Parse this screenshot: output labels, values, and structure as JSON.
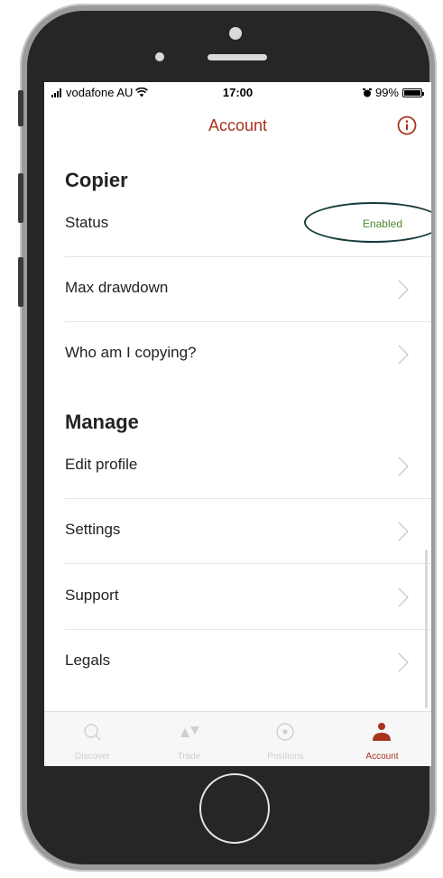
{
  "status_bar": {
    "carrier": "vodafone AU",
    "time": "17:00",
    "battery": "99%",
    "battery_level": 0.99
  },
  "nav": {
    "title": "Account",
    "info_icon": "info-circle-icon"
  },
  "sections": {
    "copier": {
      "title": "Copier",
      "status_label": "Status",
      "status_value": "Enabled",
      "max_drawdown_label": "Max drawdown",
      "who_copying_label": "Who am I copying?"
    },
    "manage": {
      "title": "Manage",
      "edit_profile_label": "Edit profile",
      "settings_label": "Settings",
      "support_label": "Support",
      "legals_label": "Legals"
    }
  },
  "tabs": [
    {
      "label": "Discover",
      "icon": "search-icon",
      "active": false
    },
    {
      "label": "Trade",
      "icon": "trade-arrows-icon",
      "active": false
    },
    {
      "label": "Positions",
      "icon": "target-icon",
      "active": false
    },
    {
      "label": "Account",
      "icon": "person-icon",
      "active": true
    }
  ],
  "colors": {
    "accent": "#a8341e",
    "status_enabled": "#4c8a2e",
    "annotation_oval": "#173a3a"
  }
}
